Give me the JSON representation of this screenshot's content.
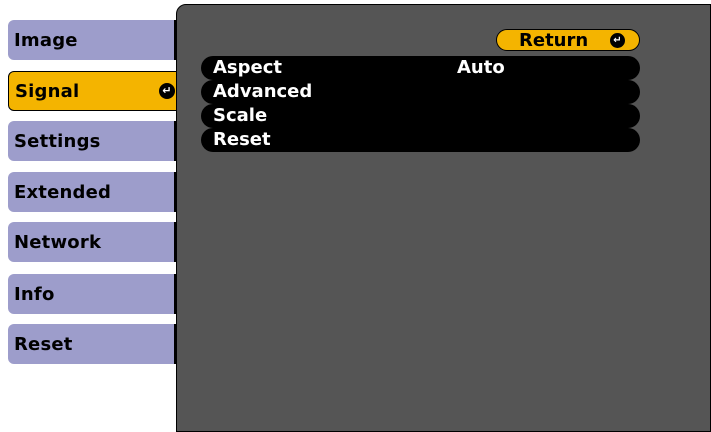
{
  "menu": {
    "items": [
      {
        "label": "Image"
      },
      {
        "label": "Signal"
      },
      {
        "label": "Settings"
      },
      {
        "label": "Extended"
      },
      {
        "label": "Network"
      },
      {
        "label": "Info"
      },
      {
        "label": "Reset"
      }
    ],
    "selected": "Signal"
  },
  "panel": {
    "return_label": "Return",
    "rows": [
      {
        "label": "Aspect",
        "value": "Auto"
      },
      {
        "label": "Advanced",
        "value": ""
      },
      {
        "label": "Scale",
        "value": ""
      },
      {
        "label": "Reset",
        "value": ""
      }
    ]
  },
  "icons": {
    "enter": "enter-icon"
  },
  "colors": {
    "menu_item": "#9d9dcb",
    "selected": "#f4b400",
    "panel_bg": "#555555",
    "row_bg": "#000000"
  }
}
